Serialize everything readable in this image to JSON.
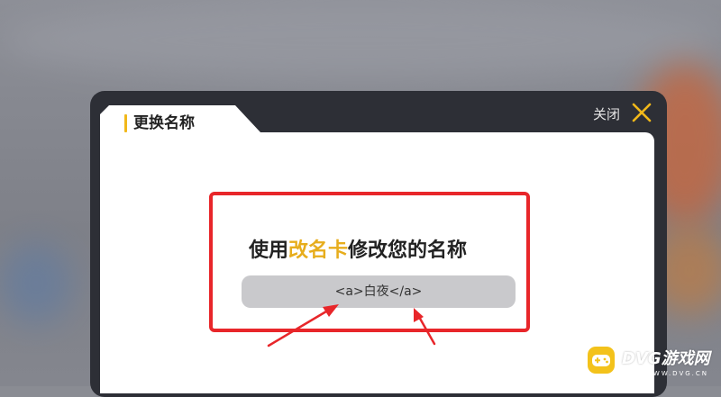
{
  "dialog": {
    "title": "更换名称",
    "close_label": "关闭",
    "close_icon": "close-icon"
  },
  "content": {
    "heading_prefix": "使用",
    "heading_highlight": "改名卡",
    "heading_suffix": "修改您的名称",
    "name_value": "<a>白夜</a>"
  },
  "colors": {
    "accent": "#f1b81a",
    "highlight_text": "#e7ad1c",
    "annotation_red": "#e8262a",
    "frame": "#2d2f36"
  },
  "watermark": {
    "brand": "DVG游戏网",
    "url": "WWW.DVG.CN",
    "icon": "gamepad-icon"
  }
}
